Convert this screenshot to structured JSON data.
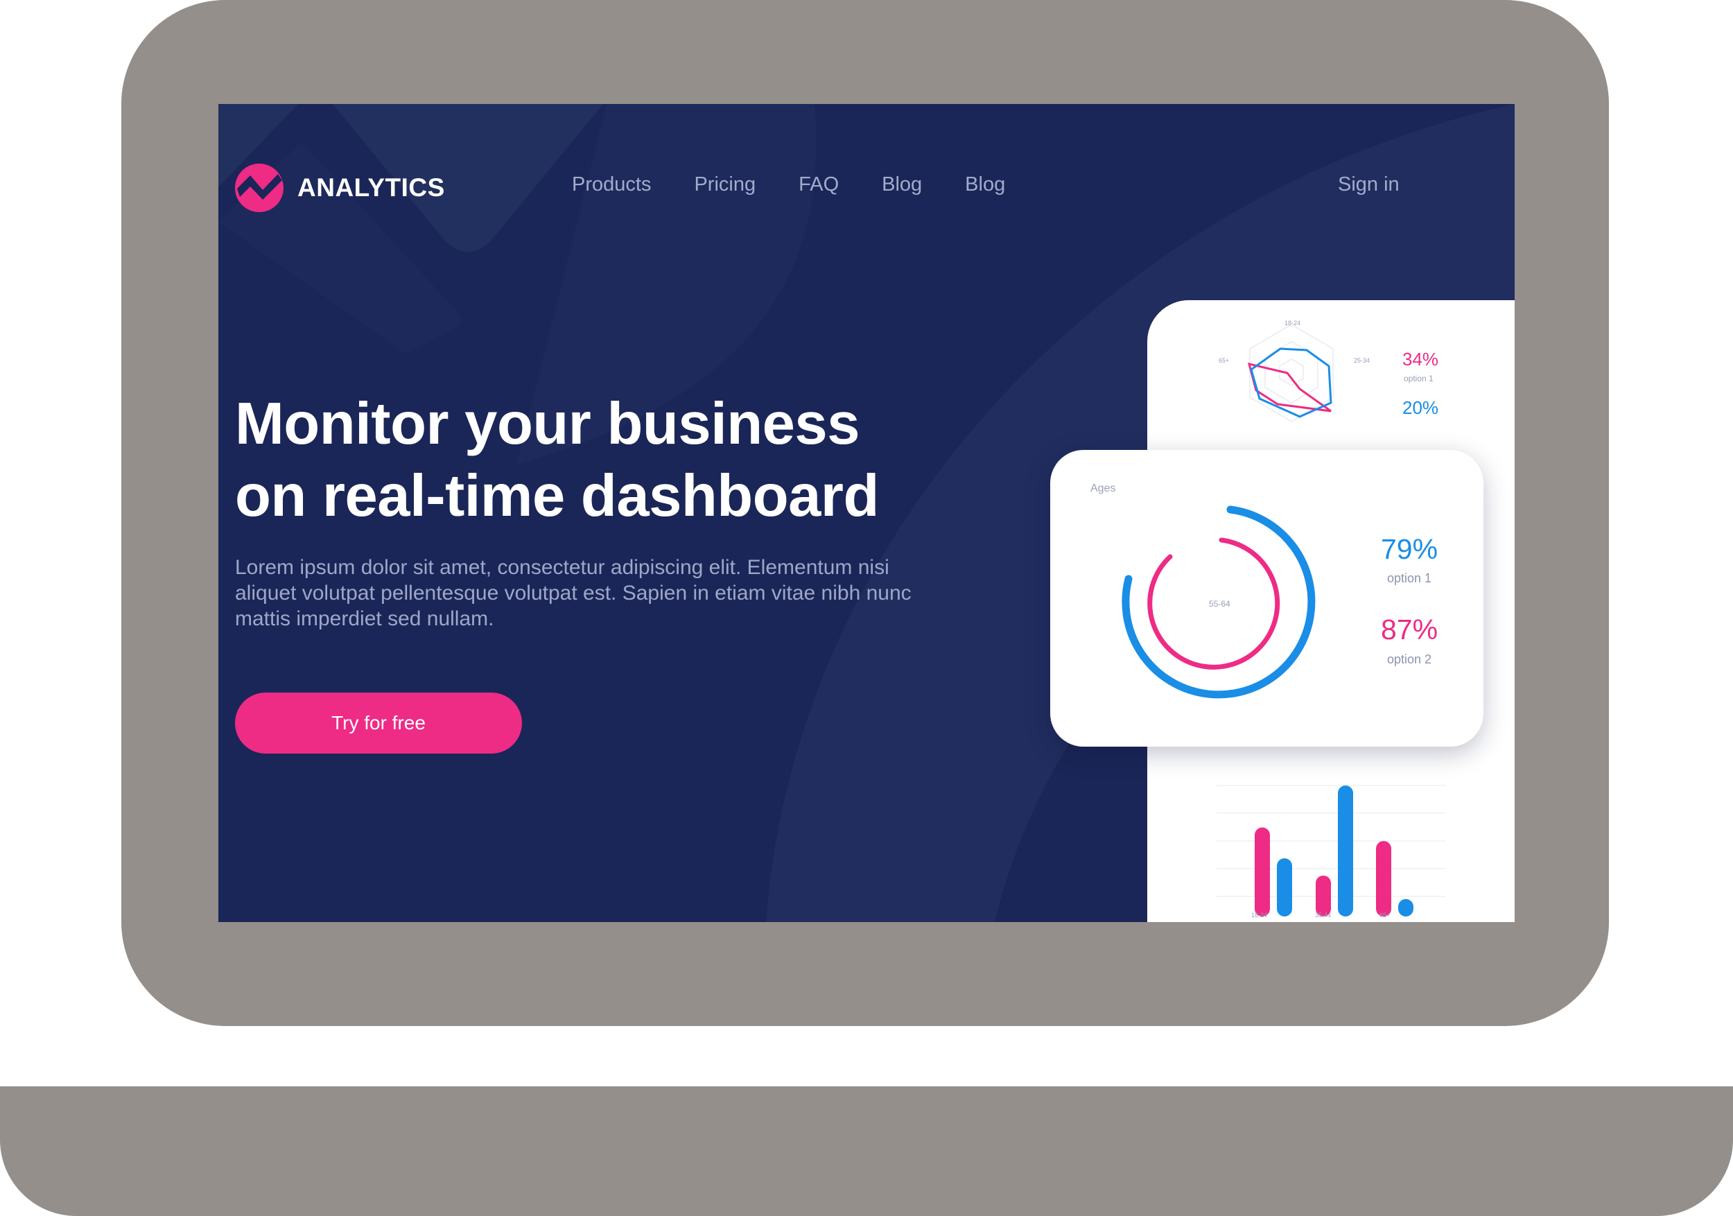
{
  "brand": {
    "name": "ANALYTICS",
    "accent": "#ee2b85",
    "secondary": "#1a8de6",
    "background": "#1a2657"
  },
  "nav": {
    "items": [
      "Products",
      "Pricing",
      "FAQ",
      "Blog",
      "Blog"
    ],
    "signin": "Sign in"
  },
  "hero": {
    "title_line1": "Monitor your business",
    "title_line2": "on real-time dashboard",
    "description": "Lorem ipsum dolor sit amet, consectetur adipiscing elit. Elementum nisi aliquet volutpat pellentesque volutpat est. Sapien in etiam vitae nibh nunc mattis imperdiet sed nullam.",
    "cta": "Try for free"
  },
  "radar_card": {
    "axis_labels": [
      "18-24",
      "25-34",
      "65+"
    ],
    "options": [
      {
        "value": "34%",
        "label": "option 1",
        "color": "#ee2b85"
      },
      {
        "value": "20%",
        "label": "",
        "color": "#1a8de6"
      }
    ]
  },
  "ages_card": {
    "title": "Ages",
    "center_label": "55-64",
    "options": [
      {
        "value": "79%",
        "label": "option 1",
        "color": "#1a8de6"
      },
      {
        "value": "87%",
        "label": "option 2",
        "color": "#ee2b85"
      }
    ]
  },
  "chart_data": {
    "type": "bar",
    "categories": [
      "18-24",
      "35-44",
      "65+"
    ],
    "series": [
      {
        "color": "#ee2b85",
        "values": [
          0.66,
          0.27,
          0.55
        ]
      },
      {
        "color": "#1a8de6",
        "values": [
          0.41,
          1.0,
          0.08
        ]
      }
    ],
    "xlabel": "",
    "ylabel": "",
    "grid": true
  }
}
